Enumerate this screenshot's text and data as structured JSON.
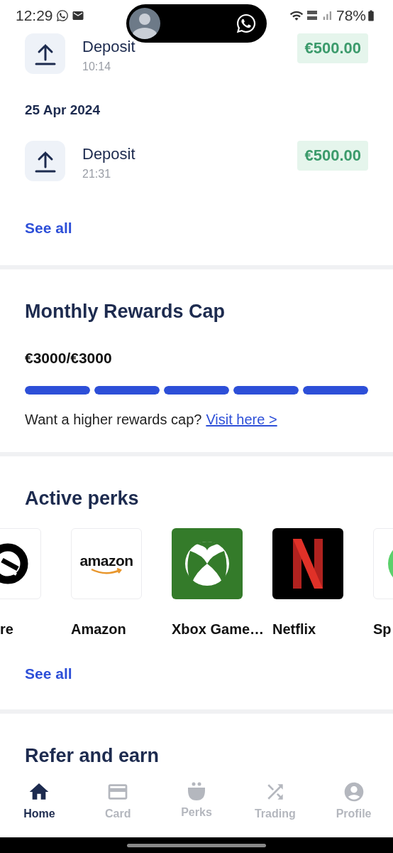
{
  "status_bar": {
    "time": "12:29",
    "battery": "78%"
  },
  "transactions": [
    {
      "items": [
        {
          "title": "Deposit",
          "time": "10:14",
          "amount": "€500.00"
        }
      ]
    },
    {
      "date": "25 Apr 2024",
      "items": [
        {
          "title": "Deposit",
          "time": "21:31",
          "amount": "€500.00"
        }
      ]
    }
  ],
  "transactions_link": "See all",
  "rewards_cap": {
    "title": "Monthly Rewards Cap",
    "amount": "€3000/€3000",
    "level": 1,
    "prompt": "Want a higher rewards cap?",
    "link": "Visit here >"
  },
  "active_perks": {
    "title": "Active perks",
    "items": [
      {
        "kind": "ring",
        "name": "re"
      },
      {
        "kind": "amazon",
        "name": "Amazon",
        "logo_text": "amazon"
      },
      {
        "kind": "xbox",
        "name": "Xbox Game…"
      },
      {
        "kind": "netflix",
        "name": "Netflix"
      },
      {
        "kind": "green_circle",
        "name": "Sp"
      }
    ],
    "link": "See all"
  },
  "refer": {
    "title": "Refer and earn"
  },
  "bottom_nav": [
    {
      "label": "Home",
      "selected": true
    },
    {
      "label": "Card",
      "selected": false
    },
    {
      "label": "Perks",
      "selected": false
    },
    {
      "label": "Trading",
      "selected": false
    },
    {
      "label": "Profile",
      "selected": false
    }
  ]
}
